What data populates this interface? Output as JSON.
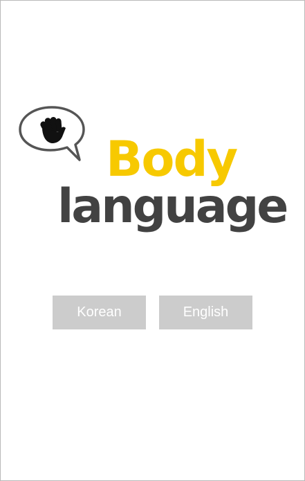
{
  "logo": {
    "word_top": "Body",
    "word_bottom": "language",
    "bubble_icon": "raised-hand-icon",
    "colors": {
      "top_word": "#f7c900",
      "bottom_word": "#424242",
      "bubble_outline": "#555555",
      "hand": "#111111"
    }
  },
  "buttons": {
    "korean_label": "Korean",
    "english_label": "English",
    "background": "#cccccc",
    "text_color": "#ffffff"
  }
}
